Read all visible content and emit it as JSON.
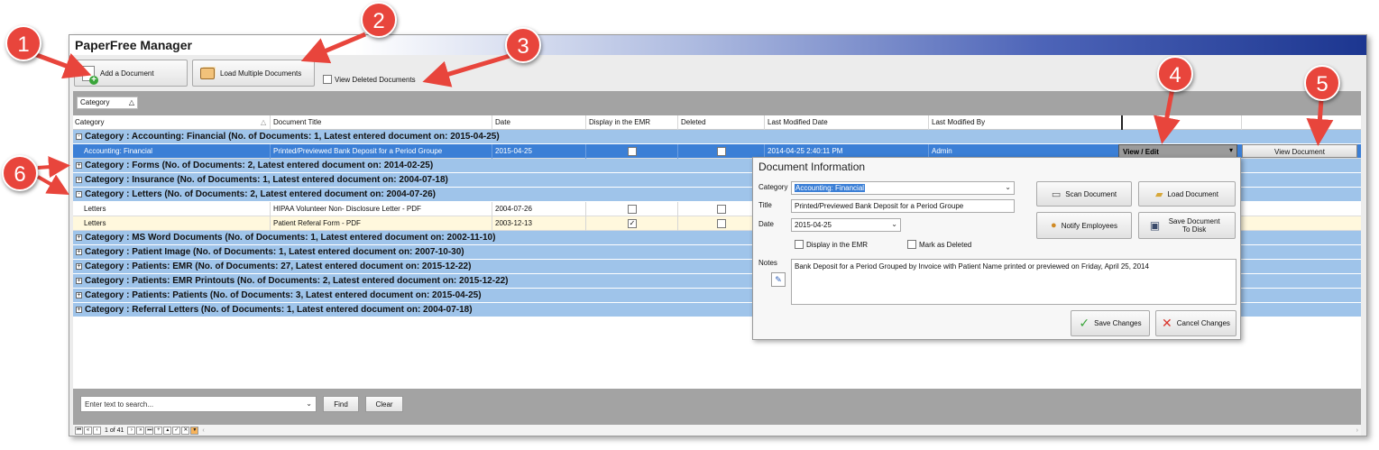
{
  "window": {
    "title": "PaperFree Manager"
  },
  "toolbar": {
    "add_document": "Add a Document",
    "load_multiple": "Load Multiple Documents",
    "view_deleted": "View Deleted Documents"
  },
  "group_panel": {
    "label": "Category",
    "sort_glyph": "△"
  },
  "columns": {
    "category": "Category",
    "category_sort": "△",
    "title": "Document Title",
    "date": "Date",
    "display_emr": "Display in the EMR",
    "deleted": "Deleted",
    "modified_date": "Last Modified Date",
    "modified_by": "Last Modified By"
  },
  "groups": [
    {
      "label": "Category : Accounting: Financial (No. of Documents: 1, Latest entered document on: 2015-04-25)",
      "state": "-"
    },
    {
      "label": "Category : Forms (No. of Documents: 2, Latest entered document on: 2014-02-25)",
      "state": "+"
    },
    {
      "label": "Category : Insurance (No. of Documents: 1, Latest entered document on: 2004-07-18)",
      "state": "+"
    },
    {
      "label": "Category : Letters (No. of Documents: 2, Latest entered document on: 2004-07-26)",
      "state": "-"
    },
    {
      "label": "Category : MS Word Documents (No. of Documents: 1, Latest entered document on: 2002-11-10)",
      "state": "+"
    },
    {
      "label": "Category : Patient Image (No. of Documents: 1, Latest entered document on: 2007-10-30)",
      "state": "+"
    },
    {
      "label": "Category : Patients: EMR (No. of Documents: 27, Latest entered document on: 2015-12-22)",
      "state": "+"
    },
    {
      "label": "Category : Patients: EMR Printouts (No. of Documents: 2, Latest entered document on: 2015-12-22)",
      "state": "+"
    },
    {
      "label": "Category : Patients: Patients (No. of Documents: 3, Latest entered document on: 2015-04-25)",
      "state": "+"
    },
    {
      "label": "Category : Referral Letters (No. of Documents: 1, Latest entered document on: 2004-07-18)",
      "state": "+"
    }
  ],
  "rows": [
    {
      "category": "Accounting: Financial",
      "title": "Printed/Previewed Bank Deposit for a Period Groupe",
      "date": "2015-04-25",
      "display_emr": "",
      "deleted": "",
      "modified_date": "2014-04-25 2:40:11 PM",
      "modified_by": "Admin"
    },
    {
      "category": "Letters",
      "title": "HIPAA Volunteer  Non- Disclosure Letter - PDF",
      "date": "2004-07-26",
      "display_emr": "",
      "deleted": ""
    },
    {
      "category": "Letters",
      "title": "Patient Referal Form - PDF",
      "date": "2003-12-13",
      "display_emr": "✓",
      "deleted": ""
    }
  ],
  "row_actions": {
    "view_edit": "View / Edit",
    "view_document": "View Document"
  },
  "doc_info": {
    "title": "Document Information",
    "category_label": "Category",
    "category_value": "Accounting: Financial",
    "title_label": "Title",
    "title_value": "Printed/Previewed Bank Deposit for a Period Groupe",
    "date_label": "Date",
    "date_value": "2015-04-25",
    "display_emr_label": "Display in the EMR",
    "mark_deleted_label": "Mark as Deleted",
    "notes_label": "Notes",
    "notes_value": "Bank Deposit for a Period Grouped by Invoice with Patient Name printed or previewed on Friday, April 25, 2014",
    "scan_document": "Scan Document",
    "load_document": "Load Document",
    "notify_employees": "Notify Employees",
    "save_to_disk": "Save Document To Disk",
    "save_changes": "Save Changes",
    "cancel_changes": "Cancel Changes"
  },
  "search": {
    "placeholder": "Enter text to search...",
    "find": "Find",
    "clear": "Clear"
  },
  "pager": {
    "text": "1 of 41"
  },
  "callouts": [
    "1",
    "2",
    "3",
    "4",
    "5",
    "6"
  ],
  "colors": {
    "group_row": "#9fc4ea",
    "selected_row": "#3b7fd6",
    "callout": "#e8453c",
    "title_gradient_end": "#1c3690"
  }
}
